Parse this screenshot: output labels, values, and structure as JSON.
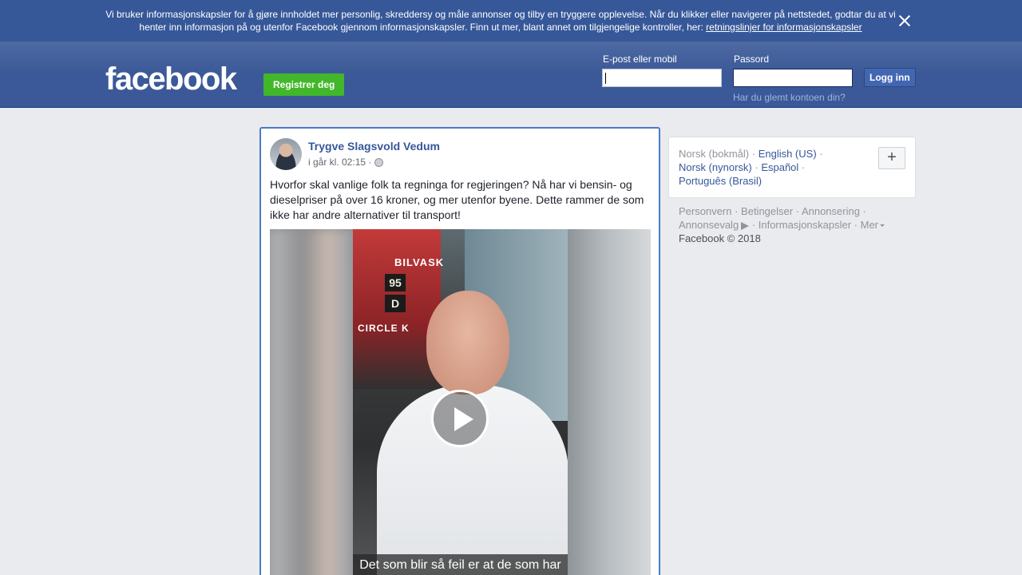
{
  "cookie_banner": {
    "text": "Vi bruker informasjonskapsler for å gjøre innholdet mer personlig, skreddersy og måle annonser og tilby en tryggere opplevelse. Når du klikker eller navigerer på nettstedet, godtar du at vi henter inn informasjon på og utenfor Facebook gjennom informasjonskapsler. Finn ut mer, blant annet om tilgjengelige kontroller, her: ",
    "link": "retningslinjer for informasjonskapsler"
  },
  "header": {
    "logo": "facebook",
    "register_label": "Registrer deg",
    "email_label": "E-post eller mobil",
    "password_label": "Passord",
    "login_label": "Logg inn",
    "forgot_label": "Har du glemt kontoen din?"
  },
  "post": {
    "author": "Trygve Slagsvold Vedum",
    "timestamp": "i går kl. 02:15 ·",
    "text": "Hvorfor skal vanlige folk ta regninga for regjeringen? Nå har vi bensin- og dieselpriser på over 16 kroner, og mer utenfor byene. Dette rammer de som ikke har andre alternativer til transport!",
    "video": {
      "sign_bilvask": "BILVASK",
      "sign_circle": "CIRCLE K",
      "price_95": "95",
      "price_d": "D",
      "subtitle": "Det som blir så feil er at de som har"
    }
  },
  "languages": {
    "current": "Norsk (bokmål)",
    "options": [
      "English (US)",
      "Norsk (nynorsk)",
      "Español",
      "Português (Brasil)"
    ],
    "more_label": "+"
  },
  "footer": {
    "links": [
      "Personvern",
      "Betingelser",
      "Annonsering",
      "Annonsevalg",
      "Informasjonskapsler",
      "Mer"
    ],
    "copyright": "Facebook © 2018"
  }
}
